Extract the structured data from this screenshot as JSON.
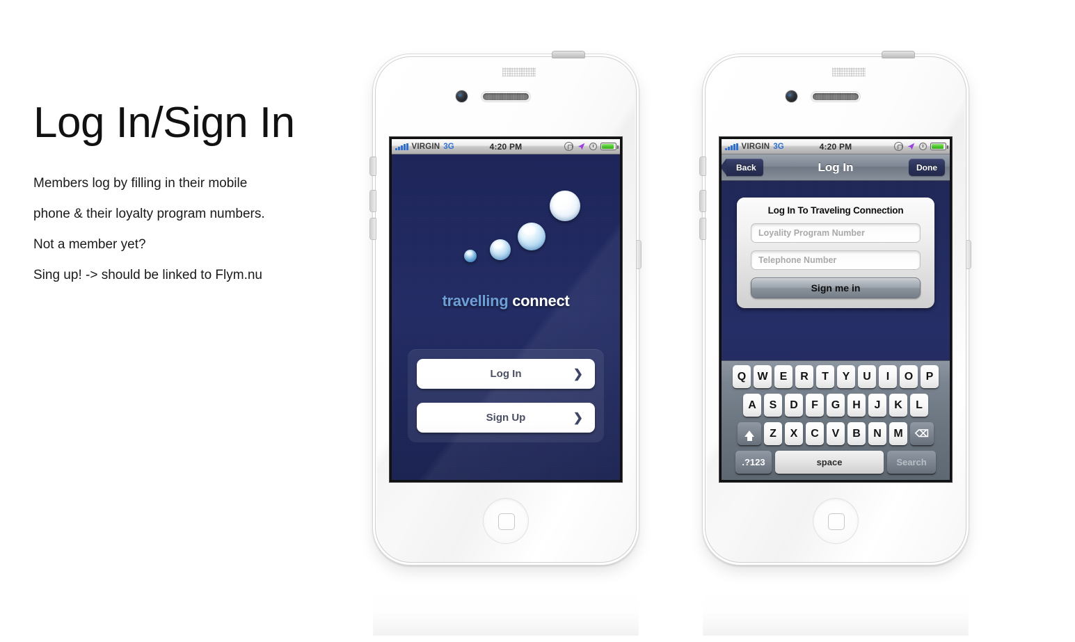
{
  "notes": {
    "title": "Log In/Sign In",
    "lines": [
      "Members log by filling in their mobile",
      "phone & their loyalty program numbers.",
      "Not a member yet?",
      "Sing up! -> should be linked to Flym.nu"
    ]
  },
  "colors": {
    "screen_navy": "#232c64",
    "brand_blue": "#6e9fd6",
    "accent_3g": "#2f6fd0",
    "nav_button_navy": "#2a3156",
    "battery_green": "#46c226"
  },
  "status_bar": {
    "carrier": "VIRGIN",
    "network": "3G",
    "time": "4:20 PM",
    "icons": {
      "signal": "signal-bars-icon",
      "rotation_lock": "rotation-lock-icon",
      "location": "location-arrow-icon",
      "alarm": "clock-icon",
      "battery": "battery-icon"
    }
  },
  "phone_1": {
    "label": "splash-screen",
    "brand": {
      "word_1": "travelling",
      "word_2": "connect"
    },
    "buttons": [
      {
        "label": "Log In",
        "chevron": "❯"
      },
      {
        "label": "Sign Up",
        "chevron": "❯"
      }
    ]
  },
  "phone_2": {
    "label": "login-screen",
    "navbar": {
      "back": "Back",
      "title": "Log In",
      "done": "Done"
    },
    "form": {
      "title": "Log In To Traveling Connection",
      "fields": [
        {
          "placeholder": "Loyality Program Number"
        },
        {
          "placeholder": "Telephone Number"
        }
      ],
      "submit": "Sign me in"
    },
    "keyboard": {
      "row_1": [
        "Q",
        "W",
        "E",
        "R",
        "T",
        "Y",
        "U",
        "I",
        "O",
        "P"
      ],
      "row_2": [
        "A",
        "S",
        "D",
        "F",
        "G",
        "H",
        "J",
        "K",
        "L"
      ],
      "row_3": [
        "Z",
        "X",
        "C",
        "V",
        "B",
        "N",
        "M"
      ],
      "shift": "shift-icon",
      "backspace": "⌫",
      "numeric": ".?123",
      "space": "space",
      "action": "Search"
    }
  }
}
